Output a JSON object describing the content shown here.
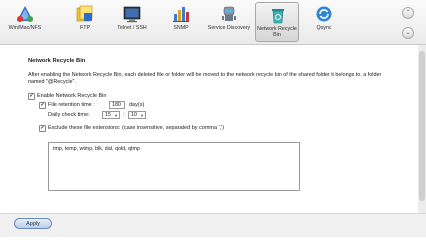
{
  "toolbar": {
    "items": [
      {
        "label": "Win/Mac/NFS",
        "icon": "network-services-icon"
      },
      {
        "label": "FTP",
        "icon": "ftp-folder-icon"
      },
      {
        "label": "Telnet / SSH",
        "icon": "terminal-icon"
      },
      {
        "label": "SNMP",
        "icon": "snmp-chart-icon"
      },
      {
        "label": "Service Discovery",
        "icon": "service-discovery-robot-icon"
      },
      {
        "label": "Network Recycle Bin",
        "icon": "recycle-bin-icon",
        "active": true
      },
      {
        "label": "Qsync",
        "icon": "qsync-icon"
      }
    ],
    "scroll_up": "⌃",
    "scroll_down": "⌄"
  },
  "main": {
    "section_title": "Network Recycle Bin",
    "description": "After enabling the Network Recycle Bin, each deleted file or folder will be moved to the network recycle bin of the shared folder it belongs to, a folder named \"@Recycle\".",
    "enable_label": "Enable Network Recycle Bin",
    "retention_label": "File retention time :",
    "retention_value": "180",
    "retention_unit": "day(s)",
    "daily_check_label": "Daily check time:",
    "check_hour": "15",
    "check_minute": "10",
    "time_separator": ":",
    "exclude_label": "Exclude these file extensions: (case insensitive, separated by comma ',')",
    "extensions_value": "tmp, temp, wtmp, blk, dat, qold, qtmp"
  },
  "footer": {
    "apply_label": "Apply"
  },
  "colors": {
    "active_tab": "#d5d5d5",
    "apply_button": "#b9cde8"
  }
}
